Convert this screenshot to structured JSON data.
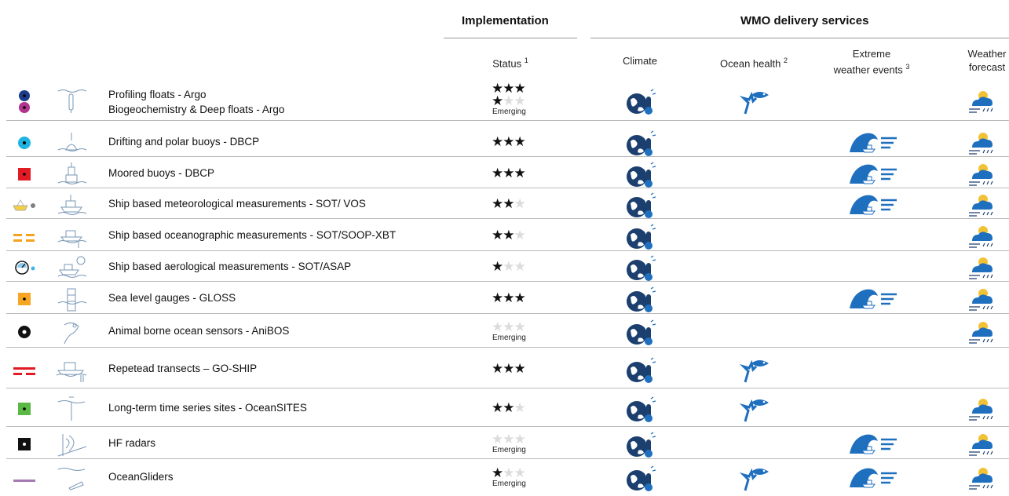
{
  "header": {
    "implementation": "Implementation",
    "wmo": "WMO delivery services"
  },
  "columns": {
    "status": "Status",
    "status_sup": "1",
    "climate": "Climate",
    "ocean_health": "Ocean health",
    "ocean_health_sup": "2",
    "extreme_line1": "Extreme",
    "extreme_line2": "weather events",
    "extreme_sup": "3",
    "weather_line1": "Weather",
    "weather_line2": "forecast"
  },
  "emerging_label": "Emerging",
  "colors": {
    "service_blue": "#1f6fbf",
    "service_dark": "#1b3f6e"
  },
  "rows": [
    {
      "label": "Profiling floats - Argo",
      "label2": "Biogeochemistry & Deep floats - Argo",
      "stars": 3,
      "stars2": 1,
      "emerging": true,
      "climate": true,
      "ocean_health": true,
      "extreme": false,
      "weather": true,
      "marker": "argo-circles-icon",
      "device": "profiling-float-icon"
    },
    {
      "label": "Drifting and polar buoys - DBCP",
      "stars": 3,
      "emerging": false,
      "climate": true,
      "ocean_health": false,
      "extreme": true,
      "weather": true,
      "marker": "cyan-circle-icon",
      "device": "drifting-buoy-icon"
    },
    {
      "label": "Moored buoys - DBCP",
      "stars": 3,
      "emerging": false,
      "climate": true,
      "ocean_health": false,
      "extreme": true,
      "weather": true,
      "marker": "red-square-icon",
      "device": "moored-buoy-icon"
    },
    {
      "label": "Ship based meteorological measurements - SOT/ VOS",
      "stars": 2,
      "emerging": false,
      "climate": true,
      "ocean_health": false,
      "extreme": true,
      "weather": true,
      "marker": "yellow-ship-icon",
      "device": "ship-met-icon"
    },
    {
      "label": "Ship based oceanographic measurements - SOT/SOOP-XBT",
      "stars": 2,
      "emerging": false,
      "climate": true,
      "ocean_health": false,
      "extreme": false,
      "weather": true,
      "marker": "orange-dash-icon",
      "device": "ship-xbt-icon"
    },
    {
      "label": "Ship based aerological measurements - SOT/ASAP",
      "stars": 1,
      "emerging": false,
      "climate": true,
      "ocean_health": false,
      "extreme": false,
      "weather": true,
      "marker": "balloon-gauge-icon",
      "device": "ship-balloon-icon"
    },
    {
      "label": "Sea level gauges - GLOSS",
      "stars": 3,
      "emerging": false,
      "climate": true,
      "ocean_health": false,
      "extreme": true,
      "weather": true,
      "marker": "orange-square-icon",
      "device": "tide-gauge-icon"
    },
    {
      "label": "Animal borne ocean sensors - AniBOS",
      "stars": 0,
      "emerging": true,
      "climate": true,
      "ocean_health": false,
      "extreme": false,
      "weather": true,
      "marker": "black-circle-icon",
      "device": "seal-sensor-icon"
    },
    {
      "label": "Repetead transects – GO-SHIP",
      "stars": 3,
      "emerging": false,
      "climate": true,
      "ocean_health": true,
      "extreme": false,
      "weather": false,
      "marker": "red-dash-icon",
      "device": "research-ship-icon"
    },
    {
      "label": "Long-term time series sites - OceanSITES",
      "stars": 2,
      "emerging": false,
      "climate": true,
      "ocean_health": true,
      "extreme": false,
      "weather": true,
      "marker": "green-square-icon",
      "device": "mooring-line-icon"
    },
    {
      "label": "HF radars",
      "stars": 0,
      "emerging": true,
      "climate": true,
      "ocean_health": false,
      "extreme": true,
      "weather": true,
      "marker": "black-square-icon",
      "device": "hf-radar-icon"
    },
    {
      "label": "OceanGliders",
      "stars": 1,
      "emerging": true,
      "climate": true,
      "ocean_health": true,
      "extreme": true,
      "weather": true,
      "marker": "purple-line-icon",
      "device": "glider-icon"
    }
  ]
}
